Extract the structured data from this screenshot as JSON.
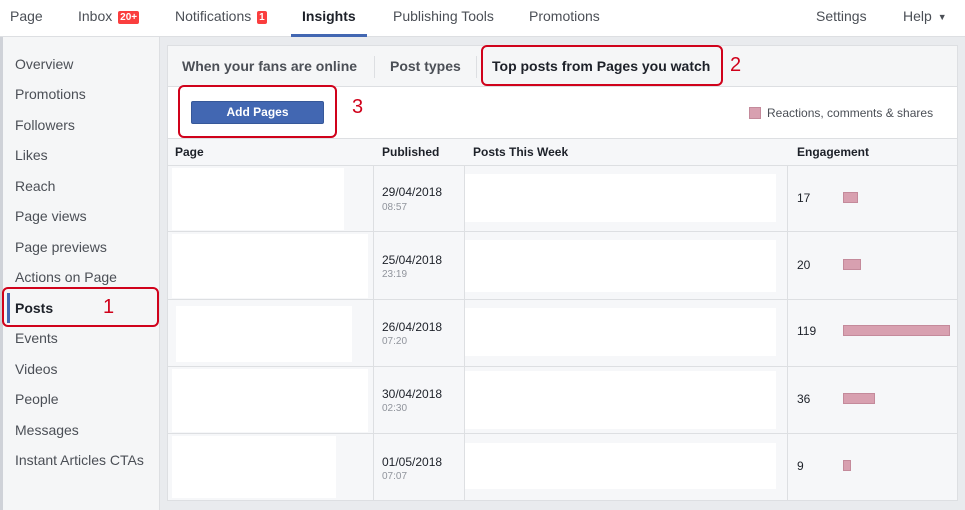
{
  "topnav": {
    "page": "Page",
    "inbox": "Inbox",
    "inbox_badge": "20+",
    "notifications": "Notifications",
    "notifications_badge": "1",
    "insights": "Insights",
    "publishing_tools": "Publishing Tools",
    "promotions": "Promotions",
    "settings": "Settings",
    "help": "Help"
  },
  "sidebar": {
    "items": [
      {
        "label": "Overview"
      },
      {
        "label": "Promotions"
      },
      {
        "label": "Followers"
      },
      {
        "label": "Likes"
      },
      {
        "label": "Reach"
      },
      {
        "label": "Page views"
      },
      {
        "label": "Page previews"
      },
      {
        "label": "Actions on Page"
      },
      {
        "label": "Posts"
      },
      {
        "label": "Events"
      },
      {
        "label": "Videos"
      },
      {
        "label": "People"
      },
      {
        "label": "Messages"
      },
      {
        "label": "Instant Articles CTAs"
      }
    ],
    "active": "Posts"
  },
  "tabs": [
    {
      "label": "When your fans are online"
    },
    {
      "label": "Post types"
    },
    {
      "label": "Top posts from Pages you watch"
    }
  ],
  "add_pages_label": "Add Pages",
  "legend_label": "Reactions, comments & shares",
  "table": {
    "headers": {
      "page": "Page",
      "published": "Published",
      "posts_this_week": "Posts This Week",
      "engagement": "Engagement"
    },
    "rows": [
      {
        "date": "29/04/2018",
        "time": "08:57",
        "engagement": "17",
        "engagement_value": 17
      },
      {
        "date": "25/04/2018",
        "time": "23:19",
        "engagement": "20",
        "engagement_value": 20
      },
      {
        "date": "26/04/2018",
        "time": "07:20",
        "engagement": "119",
        "engagement_value": 119
      },
      {
        "date": "30/04/2018",
        "time": "02:30",
        "engagement": "36",
        "engagement_value": 36
      },
      {
        "date": "01/05/2018",
        "time": "07:07",
        "engagement": "9",
        "engagement_value": 9
      }
    ]
  },
  "annotations": [
    "1",
    "2",
    "3"
  ],
  "colors": {
    "accent": "#4267b2",
    "engagement_bar": "#d8a0b0",
    "annotation": "#d0021b"
  }
}
